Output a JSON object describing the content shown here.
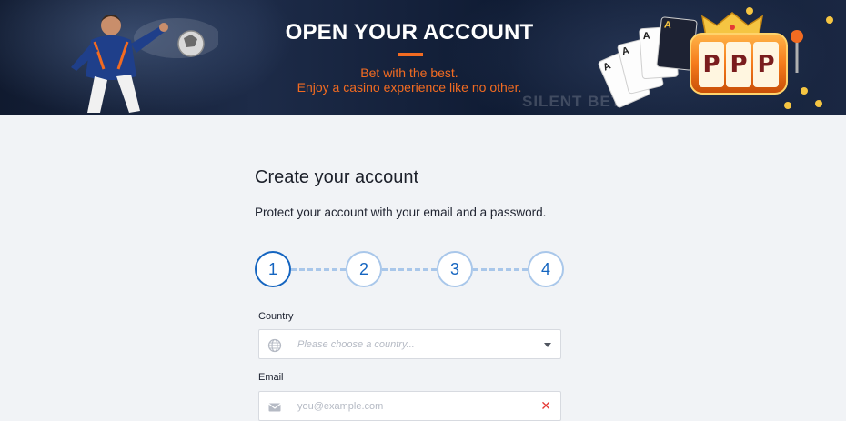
{
  "banner": {
    "title": "OPEN YOUR ACCOUNT",
    "subtitle_line1": "Bet with the best.",
    "subtitle_line2": "Enjoy a casino experience like no other.",
    "watermark": "SILENT BET",
    "accent_color": "#f26b21",
    "slot_reels": [
      "P",
      "P",
      "P"
    ],
    "cards": [
      "A",
      "A",
      "A",
      "A"
    ]
  },
  "form": {
    "heading": "Create your account",
    "subtext": "Protect your account with your email and a password.",
    "steps": [
      "1",
      "2",
      "3",
      "4"
    ],
    "active_step": 1,
    "country": {
      "label": "Country",
      "placeholder": "Please choose a country...",
      "icon": "globe-icon"
    },
    "email": {
      "label": "Email",
      "placeholder": "you@example.com",
      "icon": "envelope-icon",
      "status_icon": "error-x-icon"
    },
    "primary_color": "#1565c0",
    "error_color": "#e53935"
  }
}
